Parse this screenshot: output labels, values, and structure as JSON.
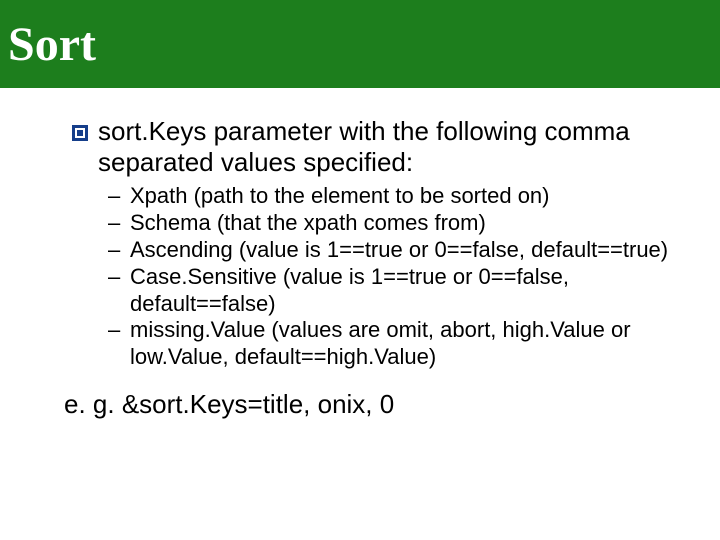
{
  "title": "Sort",
  "main_bullet": "sort.Keys parameter with the following comma separated values specified:",
  "sub": [
    "Xpath (path to the element to be sorted on)",
    "Schema (that the xpath comes from)",
    "Ascending (value is 1==true or 0==false, default==true)",
    "Case.Sensitive (value is 1==true or 0==false, default==false)",
    "missing.Value (values are omit, abort, high.Value or low.Value, default==high.Value)"
  ],
  "example": "e. g. &sort.Keys=title, onix, 0"
}
